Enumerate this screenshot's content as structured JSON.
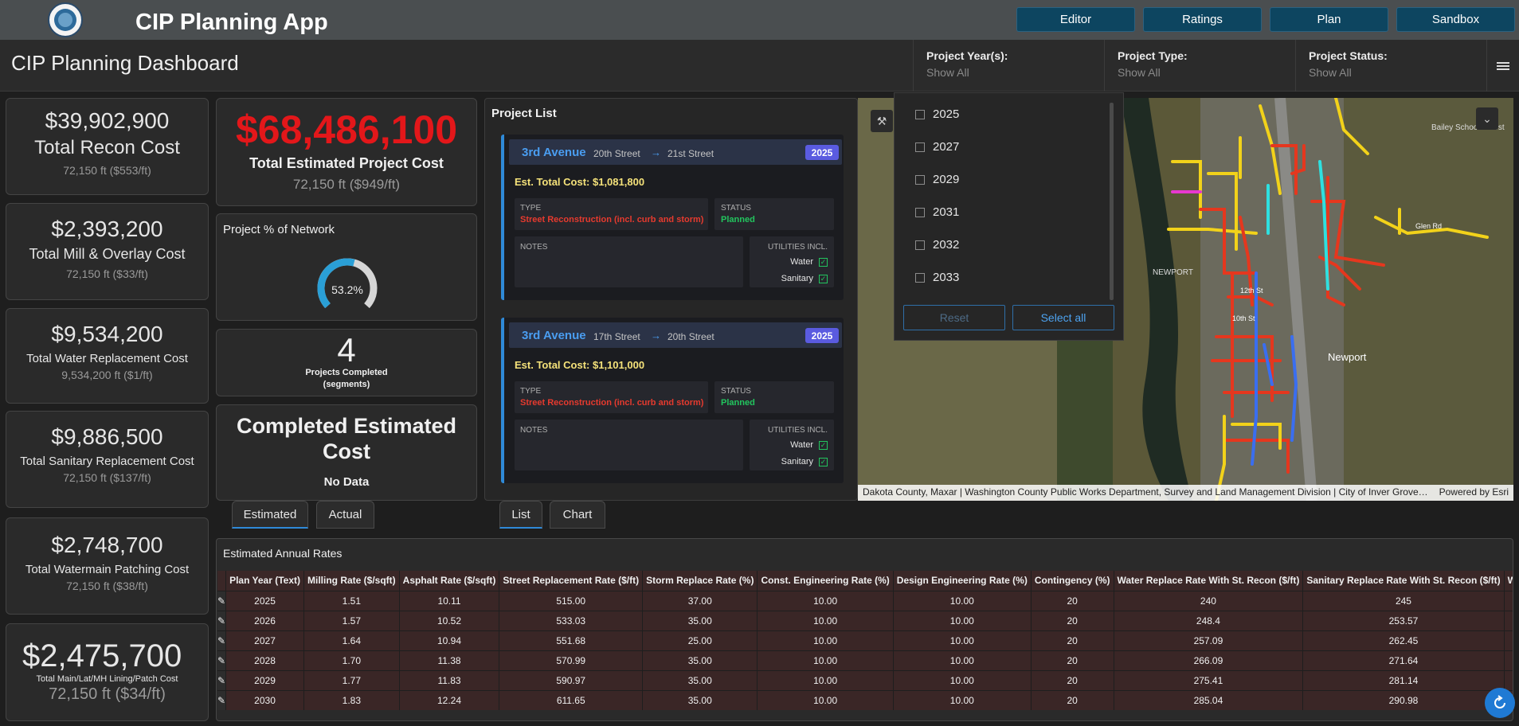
{
  "app": {
    "title": "CIP Planning App"
  },
  "nav": [
    "Editor",
    "Ratings",
    "Plan",
    "Sandbox"
  ],
  "header": {
    "title": "CIP Planning Dashboard"
  },
  "filters": [
    {
      "label": "Project Year(s):",
      "value": "Show All"
    },
    {
      "label": "Project Type:",
      "value": "Show All"
    },
    {
      "label": "Project Status:",
      "value": "Show All"
    }
  ],
  "cost_cards": [
    {
      "amount": "$39,902,900",
      "name": "Total Recon Cost",
      "sub": "72,150 ft ($553/ft)"
    },
    {
      "amount": "$2,393,200",
      "name": "Total Mill & Overlay Cost",
      "sub": "72,150 ft ($33/ft)"
    },
    {
      "amount": "$9,534,200",
      "name": "Total Water Replacement Cost",
      "sub": "9,534,200 ft ($1/ft)"
    },
    {
      "amount": "$9,886,500",
      "name": "Total Sanitary Replacement Cost",
      "sub": "72,150 ft ($137/ft)"
    },
    {
      "amount": "$2,748,700",
      "name": "Total Watermain Patching Cost",
      "sub": "72,150 ft ($38/ft)"
    },
    {
      "amount": "$2,475,700",
      "name": "Total Main/Lat/MH Lining/Patch Cost",
      "sub": "72,150 ft ($34/ft)"
    }
  ],
  "total_estimated": {
    "amount": "$68,486,100",
    "name": "Total Estimated Project Cost",
    "sub": "72,150 ft ($949/ft)"
  },
  "network_pct": {
    "title": "Project % of Network",
    "value": "53.2%",
    "fraction": 0.532
  },
  "projects_completed": {
    "count": "4",
    "label": "Projects Completed",
    "sub": "(segments)"
  },
  "completed_cost": {
    "title": "Completed Estimated Cost",
    "value": "No Data"
  },
  "project_list": {
    "title": "Project List",
    "items": [
      {
        "name": "3rd Avenue",
        "from": "20th Street",
        "to": "21st Street",
        "year": "2025",
        "cost": "Est. Total Cost: $1,081,800",
        "type_label": "TYPE",
        "type": "Street Reconstruction (incl. curb and storm)",
        "status_label": "STATUS",
        "status": "Planned",
        "notes_label": "NOTES",
        "util_label": "UTILITIES INCL.",
        "utilities": [
          "Water",
          "Sanitary"
        ]
      },
      {
        "name": "3rd Avenue",
        "from": "17th Street",
        "to": "20th Street",
        "year": "2025",
        "cost": "Est. Total Cost: $1,101,000",
        "type_label": "TYPE",
        "type": "Street Reconstruction (incl. curb and storm)",
        "status_label": "STATUS",
        "status": "Planned",
        "notes_label": "NOTES",
        "util_label": "UTILITIES INCL.",
        "utilities": [
          "Water",
          "Sanitary"
        ]
      }
    ]
  },
  "year_dropdown": {
    "options": [
      "2025",
      "2027",
      "2029",
      "2031",
      "2032",
      "2033"
    ],
    "reset": "Reset",
    "select_all": "Select all"
  },
  "map": {
    "attribution": "Dakota County, Maxar | Washington County Public Works Department, Survey and Land Management Division | City of Inver Grove…",
    "powered": "Powered by Esri",
    "labels": [
      "Newport",
      "10th St",
      "12th St",
      "Glen Rd",
      "NEWPORT",
      "Bailey School Forest"
    ]
  },
  "tabs_left": [
    "Estimated",
    "Actual"
  ],
  "tabs_right": [
    "List",
    "Chart"
  ],
  "rates": {
    "title": "Estimated Annual Rates",
    "columns": [
      "Plan Year (Text)",
      "Milling Rate ($/sqft)",
      "Asphalt Rate ($/sqft)",
      "Street Replacement Rate ($/ft)",
      "Storm Replace Rate (%)",
      "Const. Engineering Rate (%)",
      "Design Engineering Rate (%)",
      "Contingency (%)",
      "Water Replace Rate With St. Recon ($/ft)",
      "Sanitary Replace Rate With St. Recon ($/ft)",
      "W"
    ],
    "rows": [
      [
        "2025",
        "1.51",
        "10.11",
        "515.00",
        "37.00",
        "10.00",
        "10.00",
        "20",
        "240",
        "245"
      ],
      [
        "2026",
        "1.57",
        "10.52",
        "533.03",
        "35.00",
        "10.00",
        "10.00",
        "20",
        "248.4",
        "253.57"
      ],
      [
        "2027",
        "1.64",
        "10.94",
        "551.68",
        "25.00",
        "10.00",
        "10.00",
        "20",
        "257.09",
        "262.45"
      ],
      [
        "2028",
        "1.70",
        "11.38",
        "570.99",
        "35.00",
        "10.00",
        "10.00",
        "20",
        "266.09",
        "271.64"
      ],
      [
        "2029",
        "1.77",
        "11.83",
        "590.97",
        "35.00",
        "10.00",
        "10.00",
        "20",
        "275.41",
        "281.14"
      ],
      [
        "2030",
        "1.83",
        "12.24",
        "611.65",
        "35.00",
        "10.00",
        "10.00",
        "20",
        "285.04",
        "290.98"
      ]
    ]
  }
}
